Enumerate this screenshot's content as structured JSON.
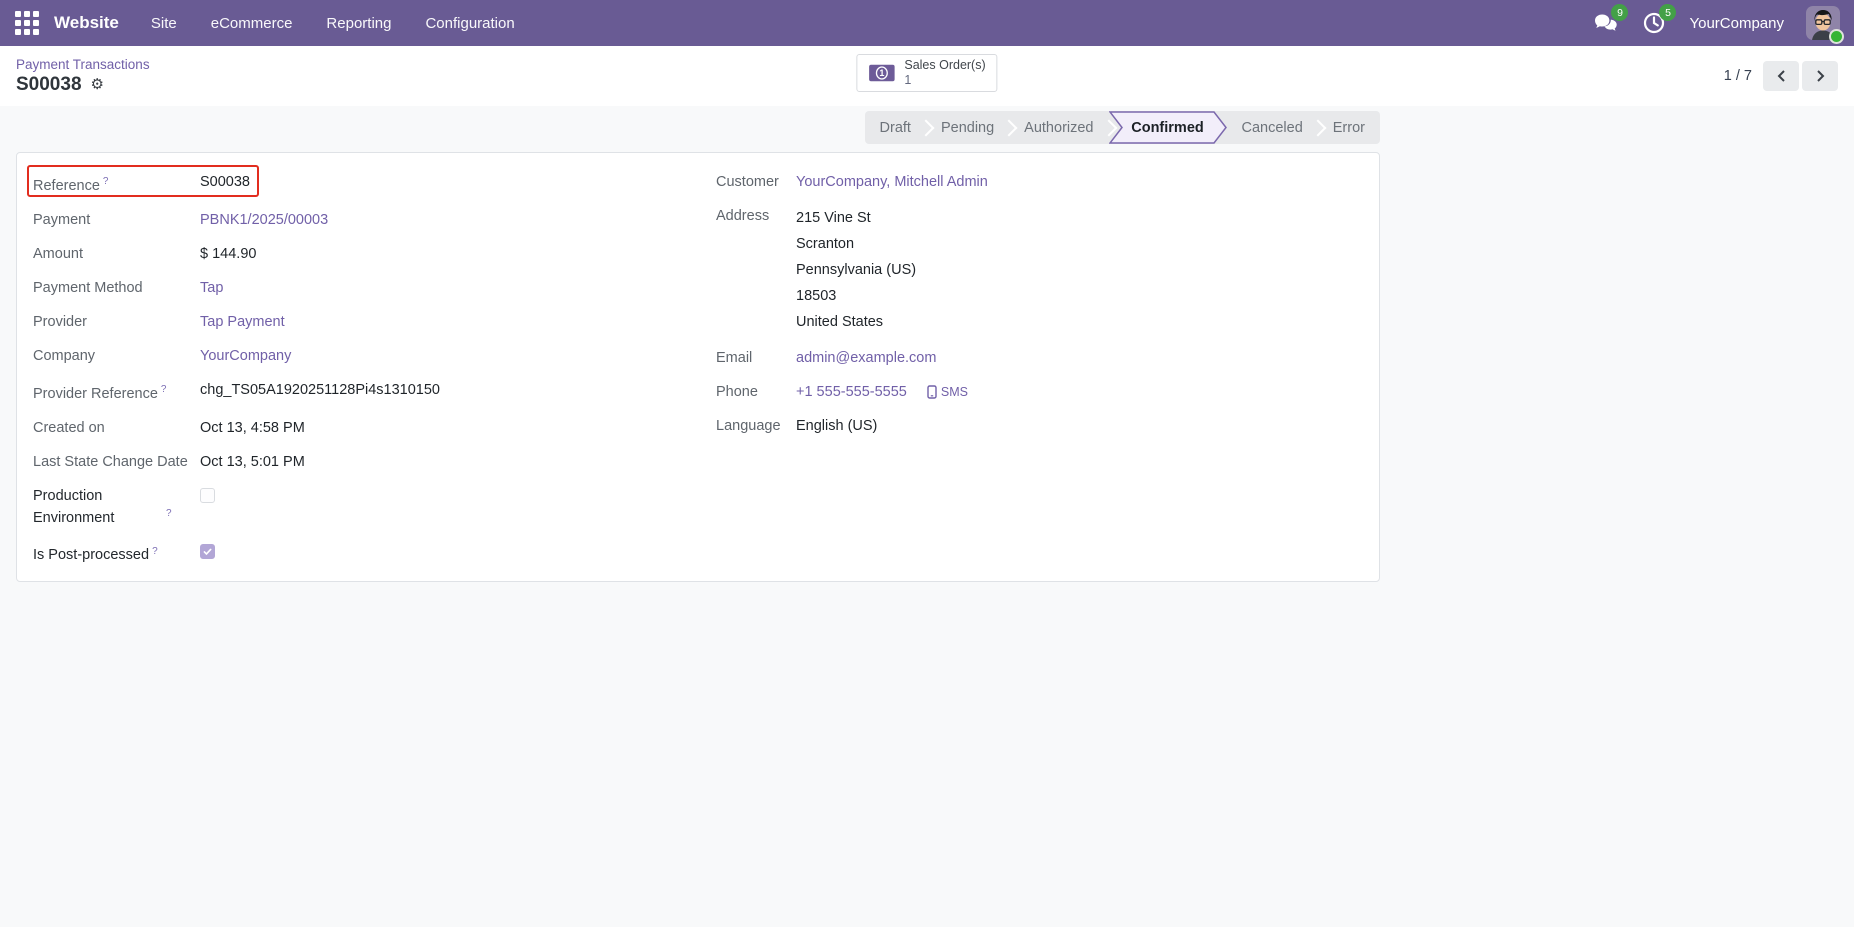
{
  "navbar": {
    "app": "Website",
    "menus": [
      "Site",
      "eCommerce",
      "Reporting",
      "Configuration"
    ],
    "messages_badge": "9",
    "activities_badge": "5",
    "user_company": "YourCompany"
  },
  "control": {
    "breadcrumb": "Payment Transactions",
    "title": "S00038",
    "stat_button": {
      "label": "Sales Order(s)",
      "count": "1"
    },
    "pager": "1 / 7"
  },
  "statusbar": {
    "steps": [
      {
        "label": "Draft",
        "active": false
      },
      {
        "label": "Pending",
        "active": false
      },
      {
        "label": "Authorized",
        "active": false
      },
      {
        "label": "Confirmed",
        "active": true
      },
      {
        "label": "Canceled",
        "active": false
      },
      {
        "label": "Error",
        "active": false
      }
    ]
  },
  "fields": {
    "left": [
      {
        "label": "Reference",
        "help": true,
        "value": "S00038",
        "type": "text",
        "highlight": true
      },
      {
        "label": "Payment",
        "value": "PBNK1/2025/00003",
        "type": "link"
      },
      {
        "label": "Amount",
        "value": "$ 144.90",
        "type": "text"
      },
      {
        "label": "Payment Method",
        "value": "Tap",
        "type": "link"
      },
      {
        "label": "Provider",
        "value": "Tap Payment",
        "type": "link"
      },
      {
        "label": "Company",
        "value": "YourCompany",
        "type": "link"
      },
      {
        "label": "Provider Reference",
        "help": true,
        "value": "chg_TS05A1920251128Pi4s1310150",
        "type": "text"
      },
      {
        "label": "Created on",
        "value": "Oct 13, 4:58 PM",
        "type": "text"
      },
      {
        "label": "Last State Change Date",
        "value": "Oct 13, 5:01 PM",
        "type": "text"
      },
      {
        "label": "Production Environment",
        "help": true,
        "type": "checkbox",
        "checked": false
      },
      {
        "label": "Is Post-processed",
        "help": true,
        "type": "checkbox",
        "checked": true
      }
    ],
    "right": {
      "customer_label": "Customer",
      "customer": "YourCompany, Mitchell Admin",
      "address_label": "Address",
      "address_lines": [
        "215 Vine St",
        "Scranton",
        "Pennsylvania (US)",
        "18503",
        "United States"
      ],
      "email_label": "Email",
      "email": "admin@example.com",
      "phone_label": "Phone",
      "phone": "+1 555-555-5555",
      "sms": "SMS",
      "language_label": "Language",
      "language": "English (US)"
    }
  },
  "colors": {
    "navbar_bg": "#695b94",
    "accent_link": "#7160a8",
    "highlight_red": "#e22d1f",
    "badge_green": "#43a047",
    "status_active_fill": "#f2eefa",
    "status_active_border": "#7b68ad",
    "checkbox_checked": "#b2a6d6"
  }
}
